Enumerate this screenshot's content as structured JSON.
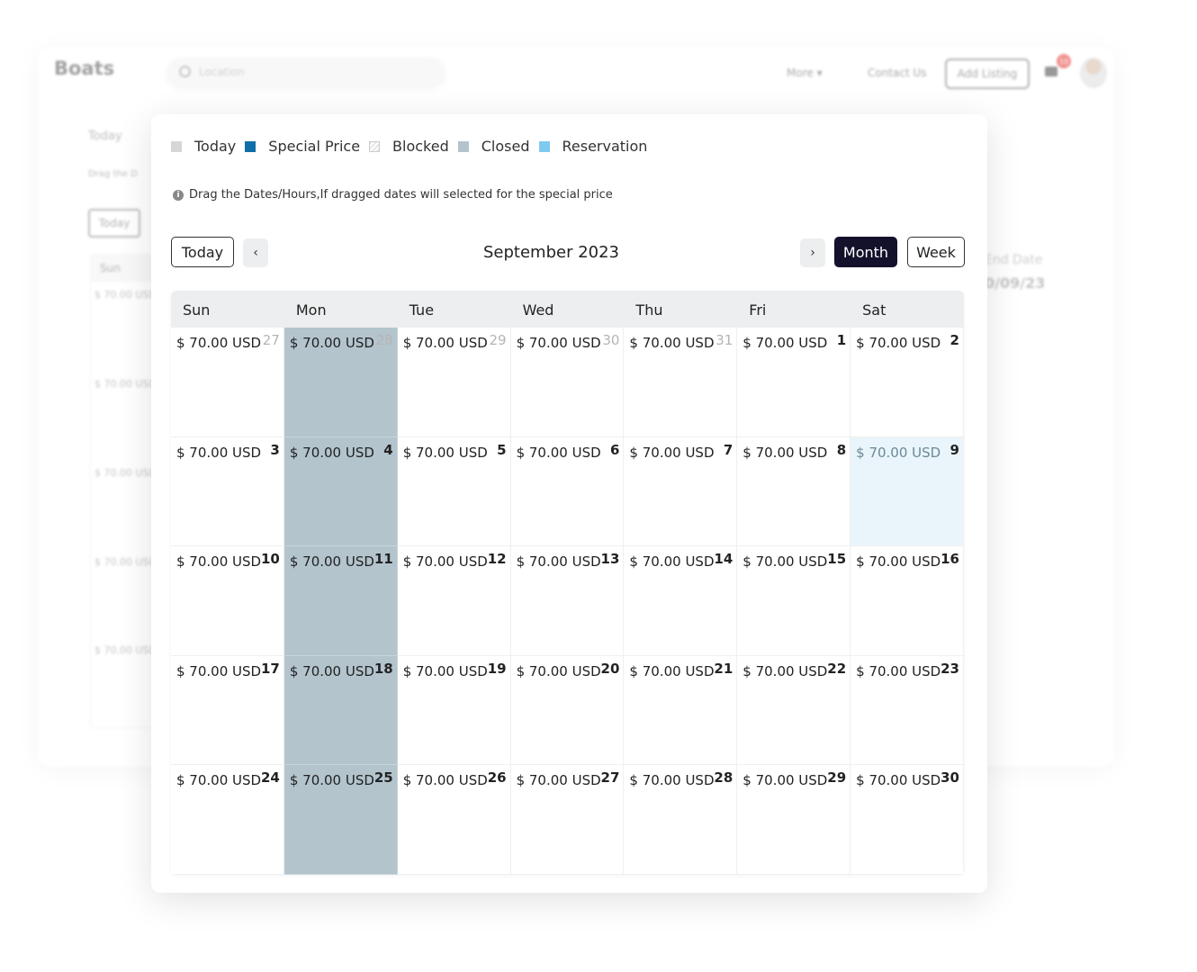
{
  "background_app": {
    "logo": "Boats",
    "search_placeholder": "Location",
    "nav": {
      "more": "More ▾",
      "contact": "Contact Us",
      "add_listing": "Add Listing"
    },
    "notification_count": "10",
    "legend_today": "Today",
    "hint_fragment": "Drag the D",
    "today_button": "Today",
    "col_header": "Sun",
    "prices": [
      "$ 70.00 USD",
      "$ 70.00 USD",
      "$ 70.00 USD",
      "$ 70.00 USD",
      "$ 70.00 USD"
    ],
    "end_date_label": "End Date",
    "end_date_value": "0/09/23"
  },
  "legend": [
    {
      "label": "Today",
      "color": "#d6d6d6"
    },
    {
      "label": "Special Price",
      "color": "#0f6fa8"
    },
    {
      "label": "Blocked",
      "color": "striped"
    },
    {
      "label": "Closed",
      "color": "#b3c4cd"
    },
    {
      "label": "Reservation",
      "color": "#7fcaf0"
    }
  ],
  "hint": "Drag the Dates/Hours,If dragged dates will selected for the special price",
  "toolbar": {
    "today": "Today",
    "prev": "‹",
    "next": "›",
    "title": "September 2023",
    "month": "Month",
    "week": "Week"
  },
  "calendar": {
    "weekdays": [
      "Sun",
      "Mon",
      "Tue",
      "Wed",
      "Thu",
      "Fri",
      "Sat"
    ],
    "price": "$ 70.00 USD",
    "weeks": [
      [
        {
          "d": "27",
          "other": true
        },
        {
          "d": "28",
          "other": true,
          "closed": true
        },
        {
          "d": "29",
          "other": true
        },
        {
          "d": "30",
          "other": true
        },
        {
          "d": "31",
          "other": true
        },
        {
          "d": "1"
        },
        {
          "d": "2"
        }
      ],
      [
        {
          "d": "3"
        },
        {
          "d": "4",
          "closed": true
        },
        {
          "d": "5"
        },
        {
          "d": "6"
        },
        {
          "d": "7"
        },
        {
          "d": "8"
        },
        {
          "d": "9",
          "today": true
        }
      ],
      [
        {
          "d": "10"
        },
        {
          "d": "11",
          "closed": true
        },
        {
          "d": "12"
        },
        {
          "d": "13"
        },
        {
          "d": "14"
        },
        {
          "d": "15"
        },
        {
          "d": "16"
        }
      ],
      [
        {
          "d": "17"
        },
        {
          "d": "18",
          "closed": true
        },
        {
          "d": "19"
        },
        {
          "d": "20"
        },
        {
          "d": "21"
        },
        {
          "d": "22"
        },
        {
          "d": "23"
        }
      ],
      [
        {
          "d": "24"
        },
        {
          "d": "25",
          "closed": true
        },
        {
          "d": "26"
        },
        {
          "d": "27"
        },
        {
          "d": "28"
        },
        {
          "d": "29"
        },
        {
          "d": "30"
        }
      ]
    ]
  }
}
